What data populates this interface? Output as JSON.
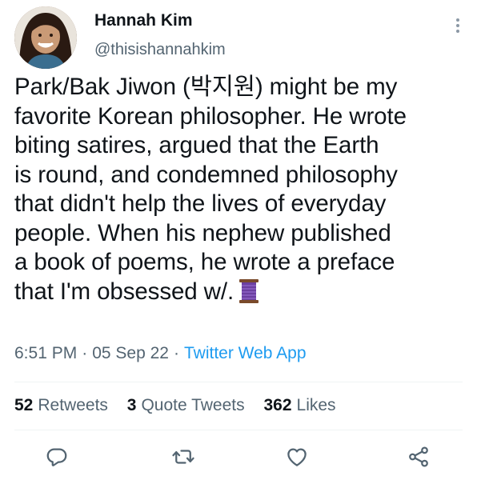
{
  "author": {
    "name": "Hannah Kim",
    "handle": "@thisishannahkim",
    "avatar_icon": "profile-photo"
  },
  "tweet": {
    "lines": [
      "Park/Bak Jiwon (박지원) might be my",
      "favorite Korean philosopher. He wrote",
      "biting satires, argued that the Earth",
      "is round, and condemned philosophy",
      "that didn't help the lives of everyday",
      "people. When his nephew published",
      "a book of poems, he wrote a preface",
      "that I'm obsessed w/."
    ],
    "emoji": "spool-of-thread"
  },
  "meta": {
    "time": "6:51 PM",
    "date": "05 Sep 22",
    "separator": "·",
    "source": "Twitter Web App"
  },
  "stats": {
    "retweets_count": "52",
    "retweets_label": "Retweets",
    "quotes_count": "3",
    "quotes_label": "Quote Tweets",
    "likes_count": "362",
    "likes_label": "Likes"
  },
  "actions": {
    "reply_icon": "reply-icon",
    "retweet_icon": "retweet-icon",
    "like_icon": "like-icon",
    "share_icon": "share-icon"
  },
  "colors": {
    "text": "#0f1419",
    "secondary": "#536471",
    "link": "#1d9bf0",
    "divider": "#eff3f4"
  }
}
